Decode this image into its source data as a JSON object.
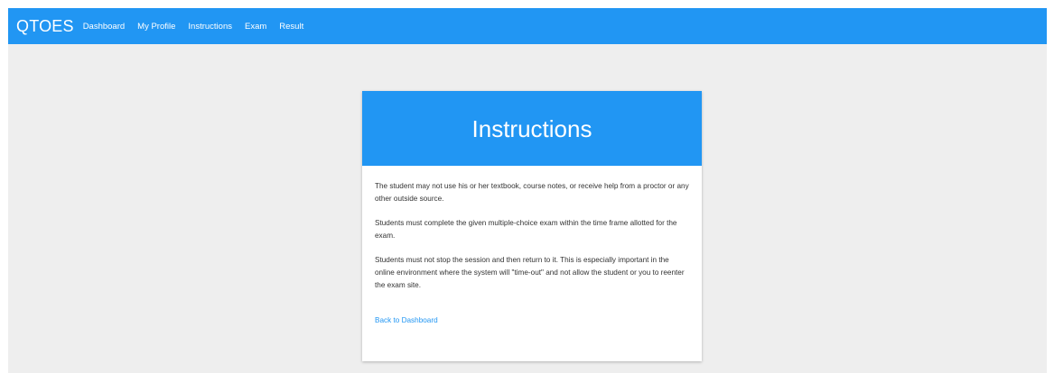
{
  "navbar": {
    "brand": "QTOES",
    "links": [
      "Dashboard",
      "My Profile",
      "Instructions",
      "Exam",
      "Result"
    ]
  },
  "card": {
    "title": "Instructions",
    "paragraphs": [
      "The student may not use his or her textbook, course notes, or receive help from a proctor or any other outside source.",
      "Students must complete the given multiple-choice exam within the time frame allotted for the exam.",
      "Students must not stop the session and then return to it. This is especially important in the online environment where the system will \"time-out\" and not allow the student or you to reenter the exam site."
    ],
    "back_link": "Back to Dashboard"
  },
  "colors": {
    "primary": "#2196f3",
    "background": "#eeeeee",
    "card": "#ffffff",
    "text": "#333333"
  }
}
